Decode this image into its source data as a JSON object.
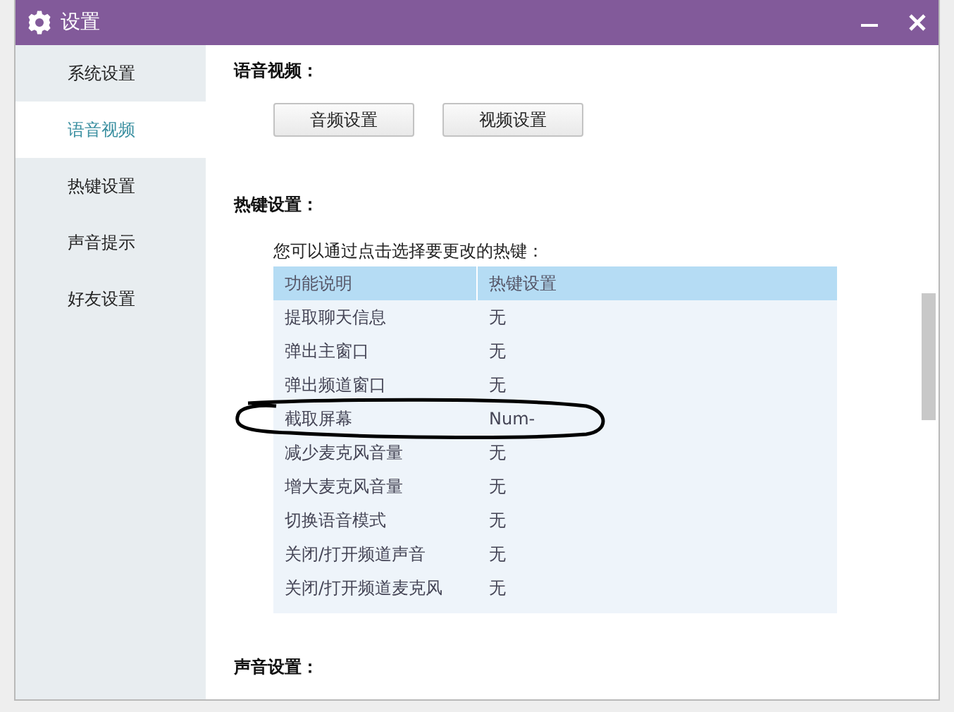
{
  "window": {
    "title": "设置"
  },
  "sidebar": {
    "items": [
      {
        "label": "系统设置",
        "selected": false
      },
      {
        "label": "语音视频",
        "selected": true
      },
      {
        "label": "热键设置",
        "selected": false
      },
      {
        "label": "声音提示",
        "selected": false
      },
      {
        "label": "好友设置",
        "selected": false
      }
    ]
  },
  "voice_video": {
    "heading": "语音视频：",
    "buttons": [
      "音频设置",
      "视频设置"
    ]
  },
  "hotkeys": {
    "heading": "热键设置：",
    "hint": "您可以通过点击选择要更改的热键：",
    "table": {
      "columns": [
        "功能说明",
        "热键设置"
      ],
      "rows": [
        {
          "cells": [
            "提取聊天信息",
            "无"
          ],
          "circled": false
        },
        {
          "cells": [
            "弹出主窗口",
            "无"
          ],
          "circled": false
        },
        {
          "cells": [
            "弹出频道窗口",
            "无"
          ],
          "circled": false
        },
        {
          "cells": [
            "截取屏幕",
            "Num-"
          ],
          "circled": true
        },
        {
          "cells": [
            "减少麦克风音量",
            "无"
          ],
          "circled": false
        },
        {
          "cells": [
            "增大麦克风音量",
            "无"
          ],
          "circled": false
        },
        {
          "cells": [
            "切换语音模式",
            "无"
          ],
          "circled": false
        },
        {
          "cells": [
            "关闭/打开频道声音",
            "无"
          ],
          "circled": false
        },
        {
          "cells": [
            "关闭/打开频道麦克风",
            "无"
          ],
          "circled": false
        }
      ]
    }
  },
  "sound": {
    "heading": "声音设置："
  }
}
